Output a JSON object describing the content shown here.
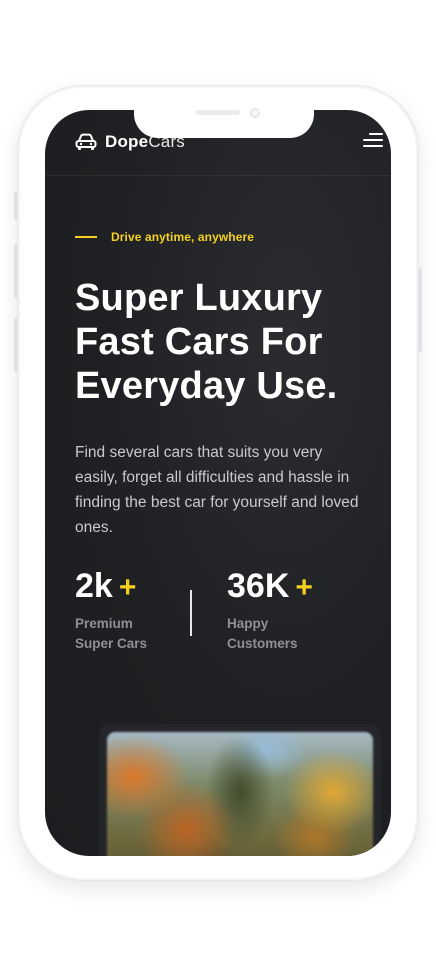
{
  "header": {
    "brand_bold": "Dope",
    "brand_light": "Cars",
    "logo_icon": "car-icon",
    "menu_icon": "hamburger-menu-icon"
  },
  "hero": {
    "tagline": "Drive anytime, anywhere",
    "headline_line1": "Super Luxury",
    "headline_line2": "Fast Cars For",
    "headline_line3": "Everyday Use.",
    "description": "Find several cars that suits you very easily, forget all difficulties and hassle in finding the best car for yourself and loved ones."
  },
  "stats": [
    {
      "number": "2k",
      "plus": "+",
      "label_line1": "Premium",
      "label_line2": "Super Cars"
    },
    {
      "number": "36K",
      "plus": "+",
      "label_line1": "Happy",
      "label_line2": "Customers"
    }
  ],
  "colors": {
    "accent": "#f5d020",
    "background": "#1f2023",
    "text": "#ffffff",
    "muted": "#8f9094"
  }
}
